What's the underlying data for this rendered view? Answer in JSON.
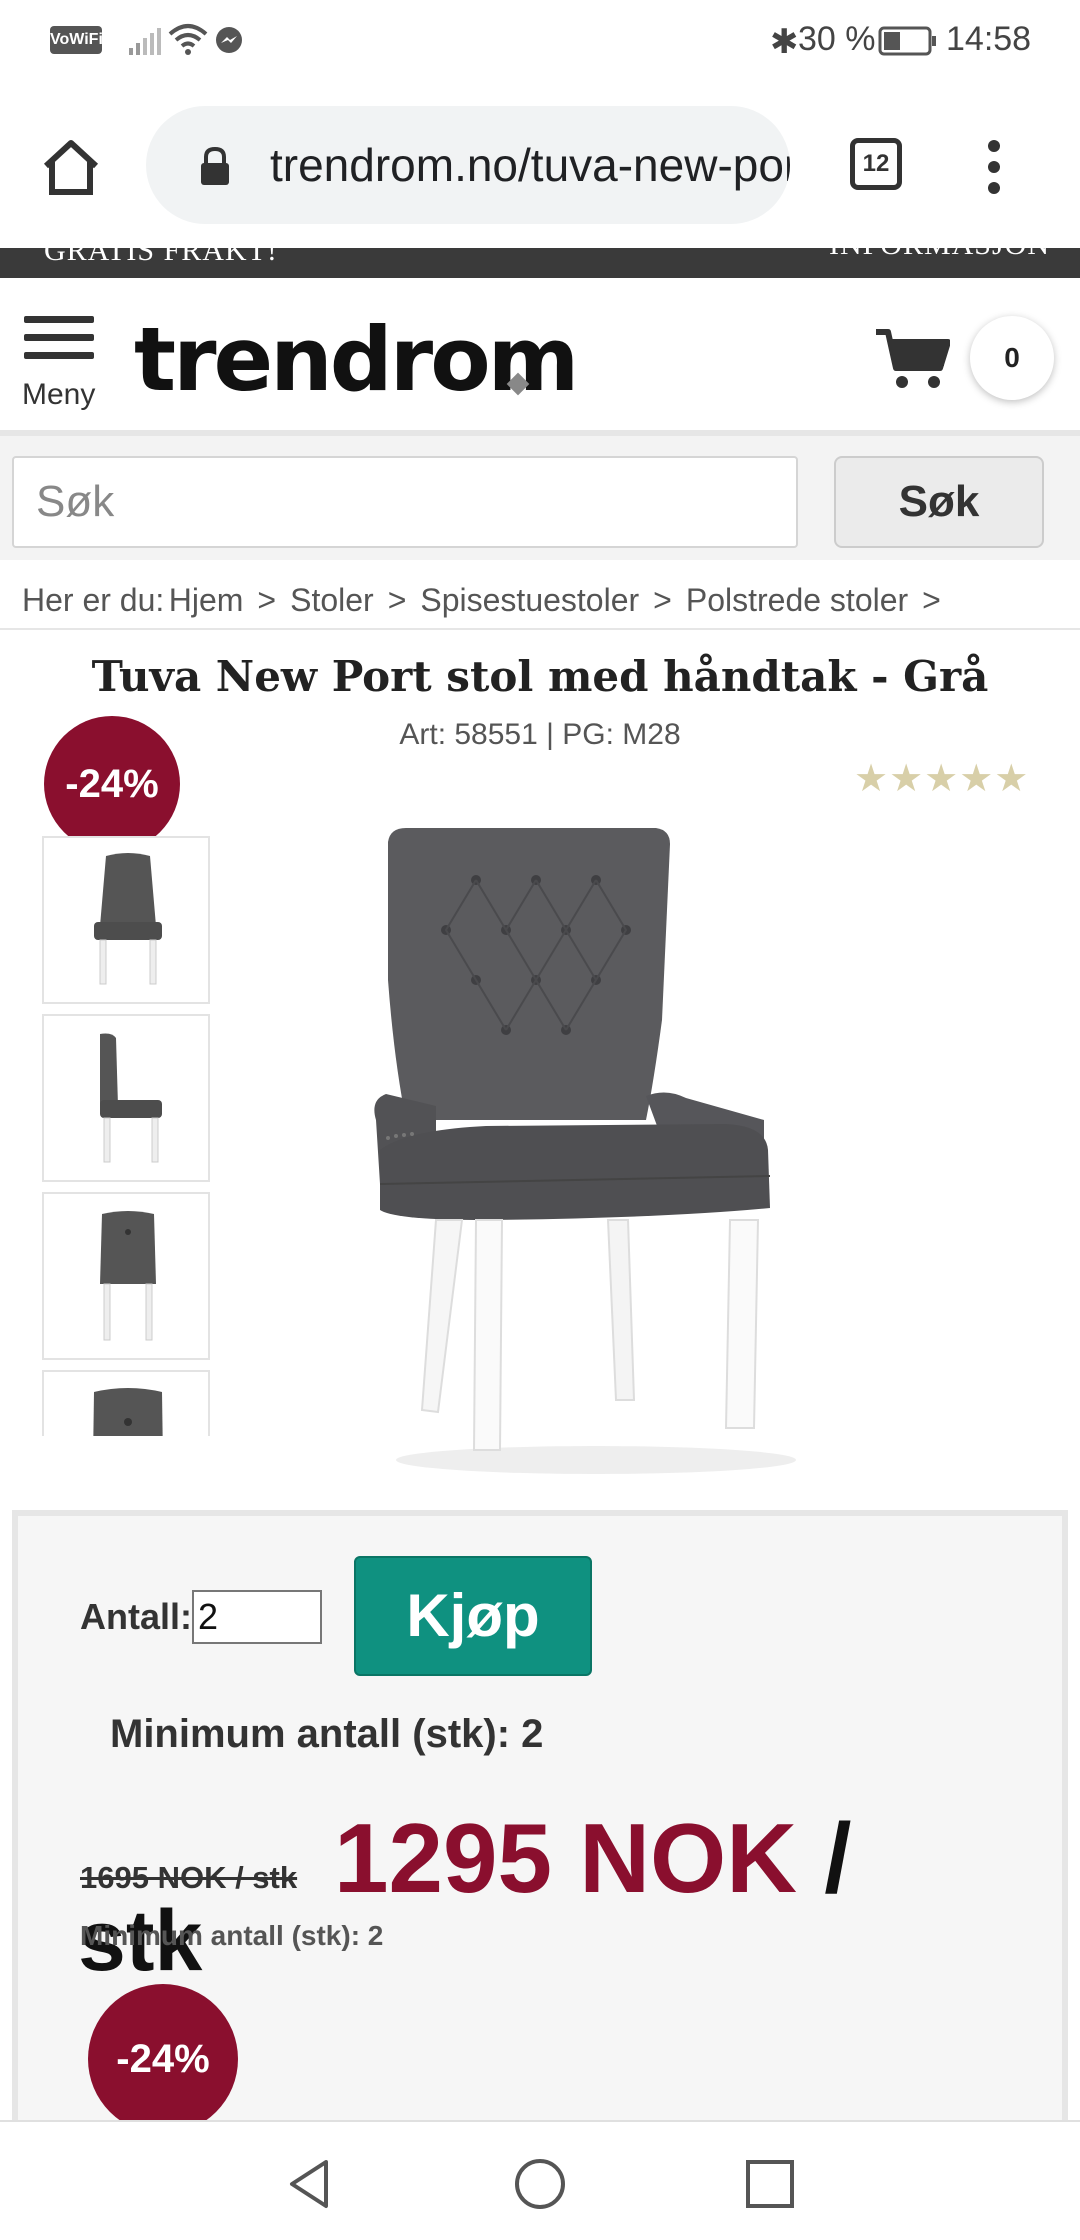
{
  "status_bar": {
    "vowifi": "VoWiFi",
    "battery_percent": "30 %",
    "time": "14:58"
  },
  "browser": {
    "url": "trendrom.no/tuva-new-port",
    "tab_count": "12"
  },
  "top_strip": {
    "left_text": "GRATIS FRAKT!",
    "right_text": "INFORMASJON"
  },
  "header": {
    "menu_label": "Meny",
    "logo_text": "trendrom",
    "cart_count": "0"
  },
  "search": {
    "placeholder": "Søk",
    "button_label": "Søk"
  },
  "breadcrumb": {
    "prefix": "Her er du:",
    "items": [
      "Hjem",
      "Stoler",
      "Spisestuestoler",
      "Polstrede stoler"
    ],
    "separator": ">"
  },
  "product": {
    "title": "Tuva New Port stol med håndtak - Grå",
    "art": "Art: 58551 | PG: M28",
    "discount_badge": "-24%",
    "rating_stars": "★★★★★",
    "thumbnail_count": 4
  },
  "purchase": {
    "quantity_label": "Antall:",
    "quantity_value": "2",
    "buy_label": "Kjøp",
    "min_quantity": "Minimum antall (stk): 2",
    "old_price": "1695 NOK / stk",
    "new_price": "1295 NOK",
    "new_price_slash": " /",
    "new_price_unit": "stk",
    "min_quantity_small": "Minimum antall (stk): 2",
    "discount_badge": "-24%"
  },
  "colors": {
    "accent_red": "#8a0f2e",
    "buy_green": "#0f9180"
  }
}
